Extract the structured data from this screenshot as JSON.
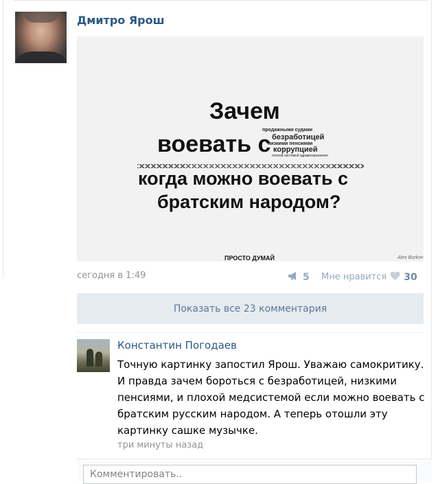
{
  "post": {
    "author": "Дмитро Ярош",
    "image": {
      "line1": "Зачем",
      "line2": "воевать с",
      "small1": "продажными судами",
      "small2": "безработицей",
      "small3": "низкими пенсиями",
      "small4": "коррупцией",
      "small5": "плохой системой здравоохранения",
      "line3": "когда можно воевать с",
      "line4": "братским народом?",
      "footer": "ПРОСТО ДУМАЙ",
      "credit": "Alex Burkov"
    },
    "time": "сегодня в 1:49",
    "shares": "5",
    "like_label": "Мне нравится",
    "likes": "30",
    "show_all_comments": "Показать все 23 комментария"
  },
  "comment": {
    "author": "Константин Погодаев",
    "text": "Точную картинку запостил Ярош. Уважаю самокритику.\nИ правда зачем бороться с безработицей, низкими\nпенсиями, и плохой медсистемой если можно воевать с\nбратским русским народом. А теперь отошли эту\nкартинку сашке музычке.",
    "time": "три минуты назад"
  },
  "composer": {
    "placeholder": "Комментировать.."
  },
  "colors": {
    "link": "#2a5885",
    "muted": "#939393",
    "button_bg": "#e5ebf1",
    "button_text": "#5f7691",
    "action": "#93a8c1"
  },
  "icons": {
    "share": "megaphone-icon",
    "like": "heart-icon"
  }
}
